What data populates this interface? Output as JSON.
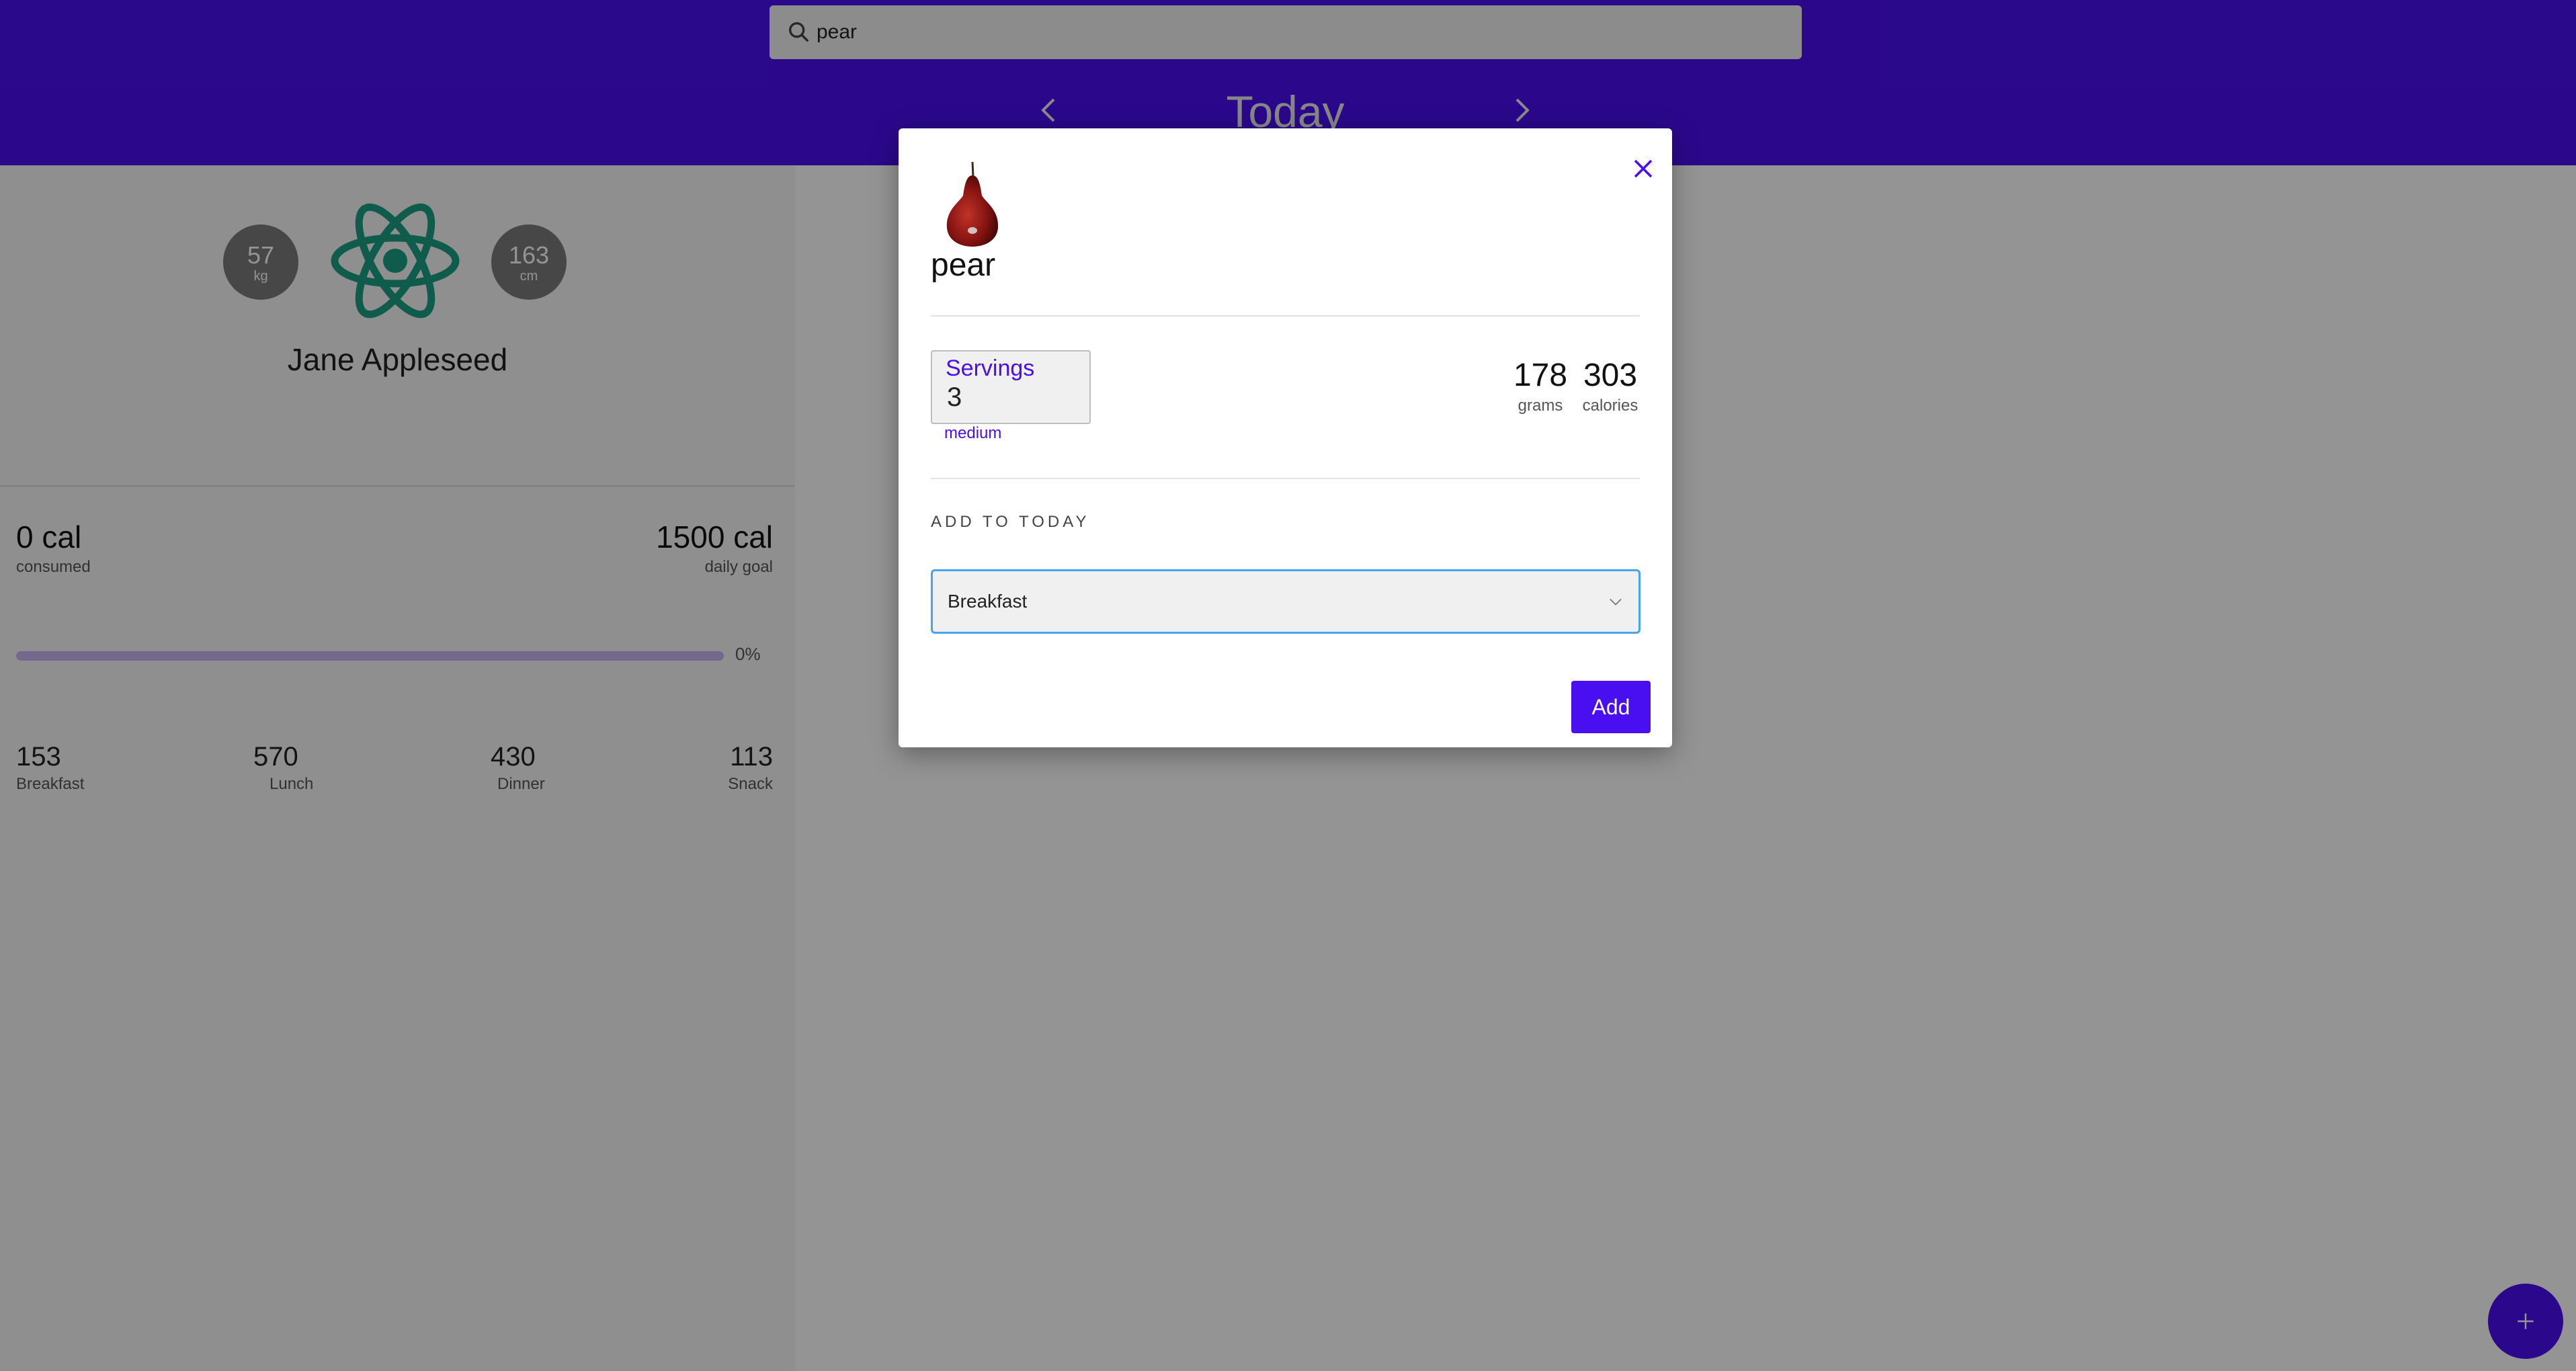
{
  "header": {
    "search": {
      "value": "pear"
    },
    "date_title": "Today"
  },
  "profile": {
    "weight": {
      "value": "57",
      "unit": "kg"
    },
    "height": {
      "value": "163",
      "unit": "cm"
    },
    "name": "Jane Appleseed"
  },
  "summary": {
    "consumed": {
      "value": "0 cal",
      "label": "consumed"
    },
    "goal": {
      "value": "1500 cal",
      "label": "daily goal"
    },
    "progress": {
      "percent": 0,
      "label": "0%"
    },
    "meals": [
      {
        "value": "153",
        "label": "Breakfast"
      },
      {
        "value": "570",
        "label": "Lunch"
      },
      {
        "value": "430",
        "label": "Dinner"
      },
      {
        "value": "113",
        "label": "Snack"
      }
    ]
  },
  "dialog": {
    "food_name": "pear",
    "servings": {
      "label": "Servings",
      "value": "3",
      "unit": "medium"
    },
    "grams": {
      "value": "178",
      "label": "grams"
    },
    "calories": {
      "value": "303",
      "label": "calories"
    },
    "add_to_label": "ADD TO TODAY",
    "meal_select": {
      "value": "Breakfast"
    },
    "add_label": "Add"
  },
  "colors": {
    "accent": "#4a0ff0",
    "react_teal": "#1a9e84",
    "select_focus": "#4aa3f0"
  }
}
